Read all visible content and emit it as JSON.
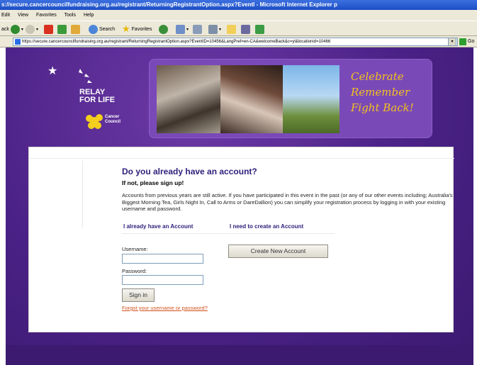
{
  "window": {
    "title": "s://secure.cancercouncilfundraising.org.au/registrant/ReturningRegistrantOption.aspx?EventI - Microsoft Internet Explorer p"
  },
  "menu": {
    "items": [
      "Edit",
      "View",
      "Favorites",
      "Tools",
      "Help"
    ]
  },
  "toolbar": {
    "back_label": "ack",
    "search_label": "Search",
    "favorites_label": "Favorites"
  },
  "address": {
    "url": "https://secure.cancercouncilfundraising.org.au/registrant/ReturningRegistrantOption.aspx?EventID=10456&LangPref=en-CA&welcomeBack&c=yl&locationid=10466",
    "go_label": "Go"
  },
  "logo": {
    "line1": "RELAY",
    "line2": "FOR LIFE",
    "council1": "Cancer",
    "council2": "Council"
  },
  "banner": {
    "slogan1": "Celebrate",
    "slogan2": "Remember",
    "slogan3": "Fight Back!"
  },
  "content": {
    "heading": "Do you already have an account?",
    "subheading": "If not, please sign up!",
    "info": "Accounts from previous years are still active. If you have participated in this event in the past (or any of our other events including; Australia's Biggest Morning Tea, Girls Night In, Call to Arms or DareDallion) you can simplify your registration process by logging in with your existing username and password.",
    "tab_existing": "I already have an Account",
    "tab_new": "I need to create an Account",
    "username_label": "Username:",
    "password_label": "Password:",
    "signin_label": "Sign in",
    "forgot_label": "Forgot your username or password?",
    "create_label": "Create New Account"
  },
  "colors": {
    "purple_bg": "#4a2186",
    "heading": "#2d1f7a",
    "slogan": "#f3c21c",
    "link": "#d2521c"
  }
}
